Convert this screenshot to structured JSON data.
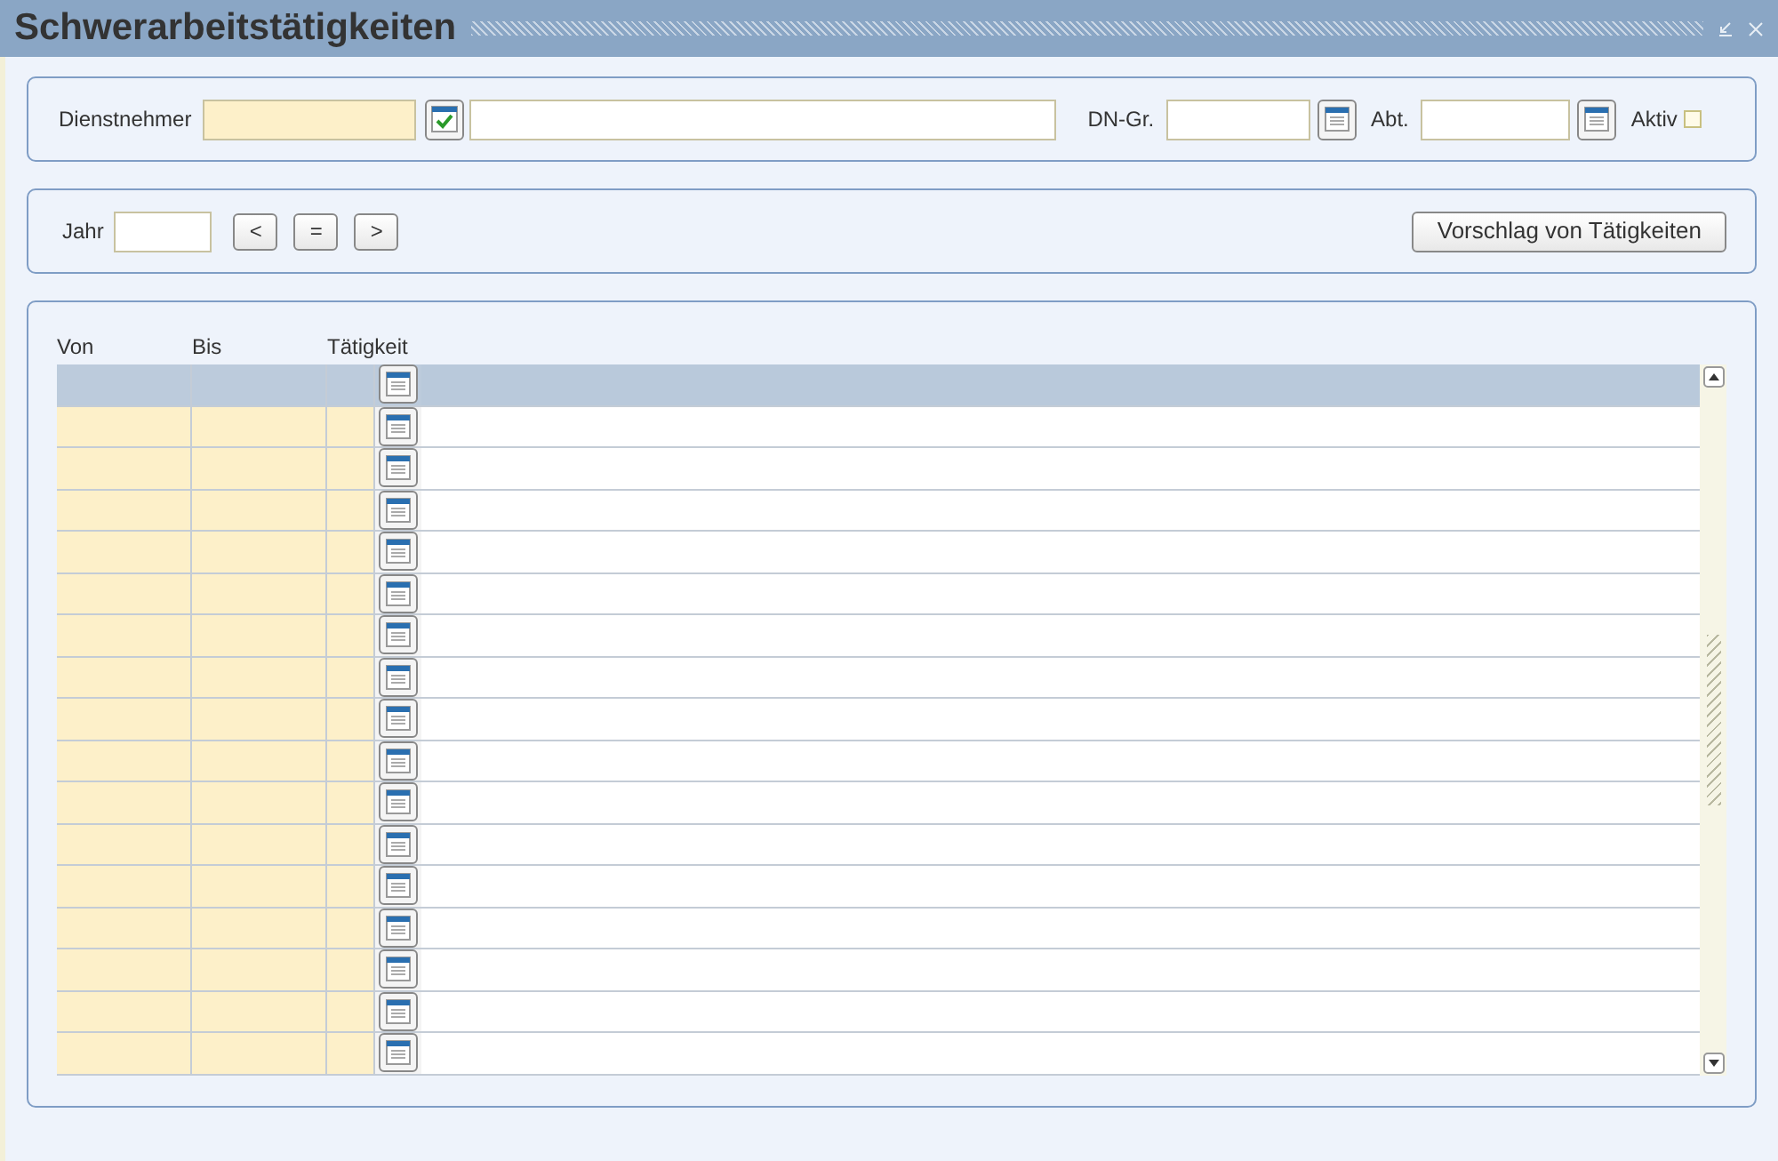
{
  "window": {
    "title": "Schwerarbeitstätigkeiten"
  },
  "employee_filter": {
    "employee_label": "Dienstnehmer",
    "group_label": "DN-Gr.",
    "department_label": "Abt.",
    "active_label": "Aktiv",
    "active_checked": false
  },
  "year_bar": {
    "year_label": "Jahr",
    "nav_buttons": [
      "<",
      "=",
      ">"
    ],
    "suggest_button": "Vorschlag von Tätigkeiten"
  },
  "table": {
    "columns": [
      "Von",
      "Bis",
      "Tätigkeit"
    ],
    "rows": [
      {
        "selected": true
      },
      {
        "selected": false
      },
      {
        "selected": false
      },
      {
        "selected": false
      },
      {
        "selected": false
      },
      {
        "selected": false
      },
      {
        "selected": false
      },
      {
        "selected": false
      },
      {
        "selected": false
      },
      {
        "selected": false
      },
      {
        "selected": false
      },
      {
        "selected": false
      },
      {
        "selected": false
      },
      {
        "selected": false
      },
      {
        "selected": false
      },
      {
        "selected": false
      },
      {
        "selected": false
      }
    ]
  }
}
